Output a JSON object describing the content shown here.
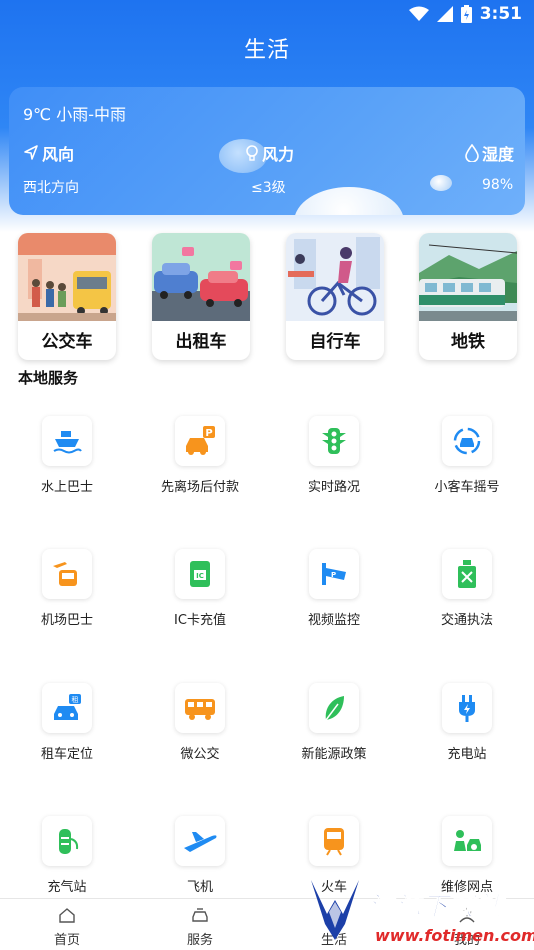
{
  "status": {
    "time": "3:51"
  },
  "header": {
    "title": "生活"
  },
  "weather": {
    "temp": "9℃ 小雨-中雨",
    "wind_dir_label": "风向",
    "wind_dir_value": "西北方向",
    "wind_power_label": "风力",
    "wind_power_value": "≤3级",
    "humidity_label": "湿度",
    "humidity_value": "98%"
  },
  "transport": [
    {
      "label": "公交车"
    },
    {
      "label": "出租车"
    },
    {
      "label": "自行车"
    },
    {
      "label": "地铁"
    }
  ],
  "section": {
    "title": "本地服务"
  },
  "services": [
    {
      "label": "水上巴士",
      "icon": "ferry-icon"
    },
    {
      "label": "先离场后付款",
      "icon": "parking-car-icon"
    },
    {
      "label": "实时路况",
      "icon": "traffic-light-icon"
    },
    {
      "label": "小客车摇号",
      "icon": "car-lottery-icon"
    },
    {
      "label": "机场巴士",
      "icon": "airport-bus-icon"
    },
    {
      "label": "IC卡充值",
      "icon": "ic-card-icon"
    },
    {
      "label": "视频监控",
      "icon": "camera-icon"
    },
    {
      "label": "交通执法",
      "icon": "enforcement-icon"
    },
    {
      "label": "租车定位",
      "icon": "rental-car-icon"
    },
    {
      "label": "微公交",
      "icon": "mini-bus-icon"
    },
    {
      "label": "新能源政策",
      "icon": "leaf-icon"
    },
    {
      "label": "充电站",
      "icon": "charging-plug-icon"
    },
    {
      "label": "充气站",
      "icon": "gas-cylinder-icon"
    },
    {
      "label": "飞机",
      "icon": "airplane-icon"
    },
    {
      "label": "火车",
      "icon": "train-icon"
    },
    {
      "label": "维修网点",
      "icon": "repair-icon"
    }
  ],
  "tabs": [
    {
      "label": "首页",
      "icon": "home-icon"
    },
    {
      "label": "服务",
      "icon": "service-car-icon"
    },
    {
      "label": "生活",
      "icon": "life-icon"
    },
    {
      "label": "我的",
      "icon": "profile-icon"
    }
  ],
  "watermark": {
    "name": "清源下载站",
    "url": "www.fotimen.com"
  },
  "colors": {
    "primary": "#1e73f0",
    "icon_blue": "#1f8bf2",
    "icon_orange": "#f7941d",
    "icon_green": "#2fbf5a"
  }
}
